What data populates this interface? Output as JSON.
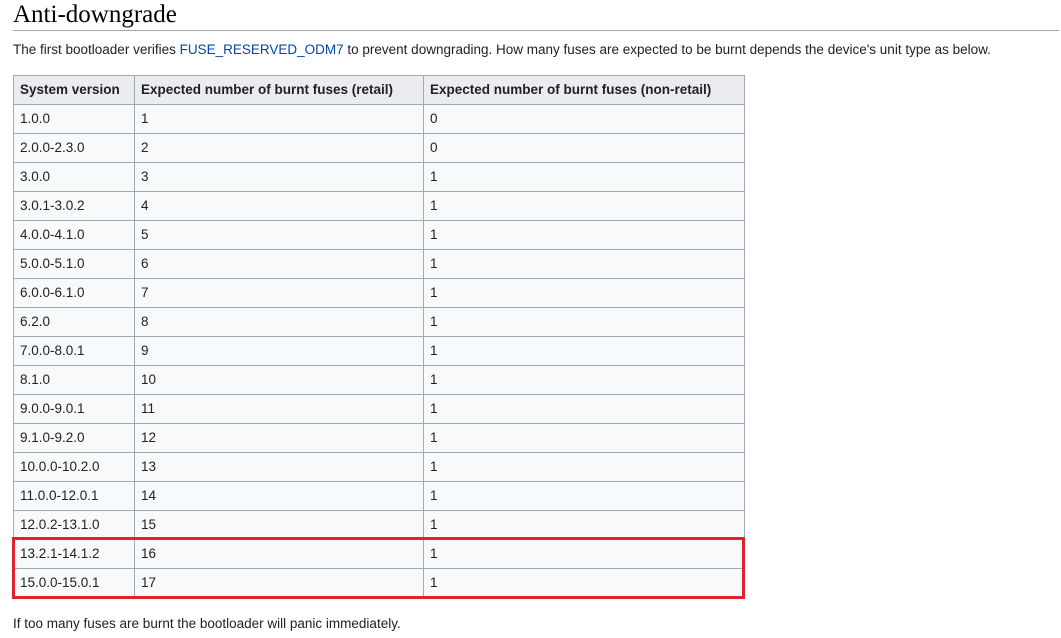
{
  "heading": "Anti-downgrade",
  "intro": {
    "before": "The first bootloader verifies ",
    "link": "FUSE_RESERVED_ODM7",
    "after": " to prevent downgrading. How many fuses are expected to be burnt depends the device's unit type as below."
  },
  "table": {
    "headers": [
      "System version",
      "Expected number of burnt fuses (retail)",
      "Expected number of burnt fuses (non-retail)"
    ],
    "rows": [
      [
        "1.0.0",
        "1",
        "0"
      ],
      [
        "2.0.0-2.3.0",
        "2",
        "0"
      ],
      [
        "3.0.0",
        "3",
        "1"
      ],
      [
        "3.0.1-3.0.2",
        "4",
        "1"
      ],
      [
        "4.0.0-4.1.0",
        "5",
        "1"
      ],
      [
        "5.0.0-5.1.0",
        "6",
        "1"
      ],
      [
        "6.0.0-6.1.0",
        "7",
        "1"
      ],
      [
        "6.2.0",
        "8",
        "1"
      ],
      [
        "7.0.0-8.0.1",
        "9",
        "1"
      ],
      [
        "8.1.0",
        "10",
        "1"
      ],
      [
        "9.0.0-9.0.1",
        "11",
        "1"
      ],
      [
        "9.1.0-9.2.0",
        "12",
        "1"
      ],
      [
        "10.0.0-10.2.0",
        "13",
        "1"
      ],
      [
        "11.0.0-12.0.1",
        "14",
        "1"
      ],
      [
        "12.0.2-13.1.0",
        "15",
        "1"
      ],
      [
        "13.2.1-14.1.2",
        "16",
        "1"
      ],
      [
        "15.0.0-15.0.1",
        "17",
        "1"
      ]
    ]
  },
  "highlight_color": "#e0212e",
  "outro": "If too many fuses are burnt the bootloader will panic immediately."
}
